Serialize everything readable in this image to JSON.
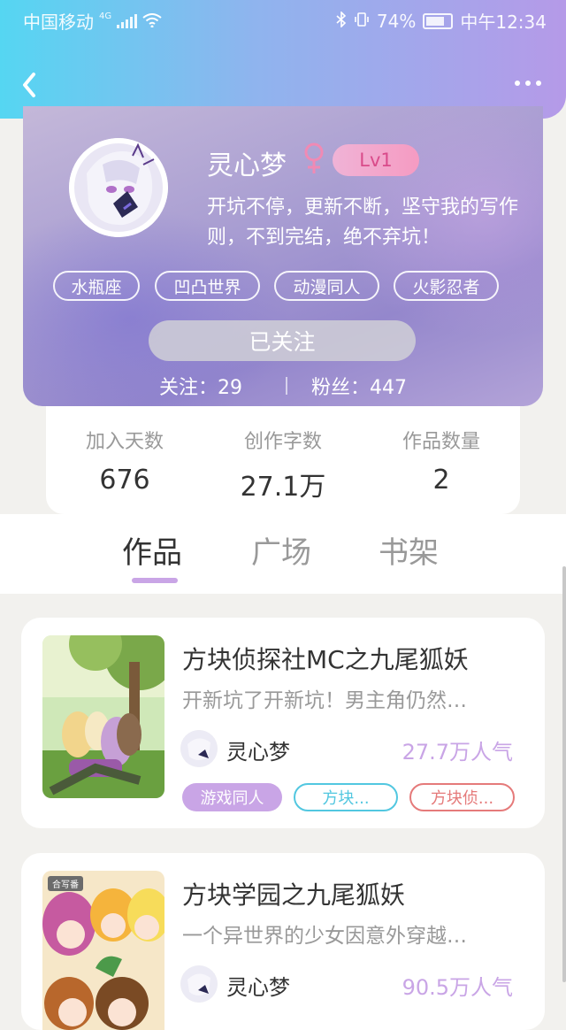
{
  "status_bar": {
    "carrier": "中国移动",
    "network": "4G",
    "battery": "74%",
    "time": "中午12:34"
  },
  "nav": {
    "back_icon": "chevron-left-icon",
    "more_icon": "more-dots-icon"
  },
  "profile": {
    "username": "灵心梦",
    "gender_icon": "female-icon",
    "level": "Lv1",
    "bio_line1": "开坑不停，更新不断，坚守我的写作",
    "bio_line2": "则，不到完结，绝不弃坑！",
    "tags": [
      "水瓶座",
      "凹凸世界",
      "动漫同人",
      "火影忍者"
    ],
    "follow_button": "已关注",
    "following_label": "关注：29",
    "fans_label": "粉丝：447"
  },
  "stats": [
    {
      "label": "加入天数",
      "value": "676"
    },
    {
      "label": "创作字数",
      "value": "27.1万"
    },
    {
      "label": "作品数量",
      "value": "2"
    }
  ],
  "tabs": [
    {
      "label": "作品",
      "active": true
    },
    {
      "label": "广场",
      "active": false
    },
    {
      "label": "书架",
      "active": false
    }
  ],
  "works": [
    {
      "title": "方块侦探社MC之九尾狐妖",
      "description": "开新坑了开新坑！男主角仍然…",
      "author": "灵心梦",
      "popularity": "27.7万人气",
      "tags": [
        {
          "label": "游戏同人",
          "style": "filled"
        },
        {
          "label": "方块...",
          "style": "cyan"
        },
        {
          "label": "方块侦...",
          "style": "red"
        }
      ]
    },
    {
      "title": "方块学园之九尾狐妖",
      "description": "一个异世界的少女因意外穿越…",
      "author": "灵心梦",
      "popularity": "90.5万人气",
      "cover_badge": "合写番"
    }
  ],
  "colors": {
    "accent": "#c9a5e6",
    "tag_cyan": "#52c7e0",
    "tag_red": "#e57a7a",
    "level_text": "#d94b8a"
  }
}
